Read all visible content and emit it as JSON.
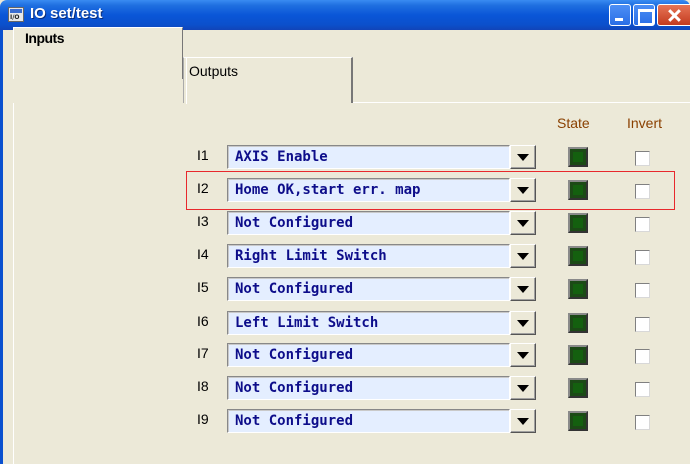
{
  "window": {
    "title": "IO set/test",
    "icon_label": "I/O"
  },
  "tabs": [
    {
      "label": "Inputs",
      "active": true
    },
    {
      "label": "Outputs",
      "active": false
    }
  ],
  "columns": {
    "state": "State",
    "invert": "Invert"
  },
  "inputs": [
    {
      "id": "I1",
      "function": "AXIS Enable",
      "state_on": true,
      "invert": false
    },
    {
      "id": "I2",
      "function": "Home OK,start err. map",
      "state_on": true,
      "invert": false
    },
    {
      "id": "I3",
      "function": "Not Configured",
      "state_on": true,
      "invert": false
    },
    {
      "id": "I4",
      "function": "Right Limit Switch",
      "state_on": true,
      "invert": false
    },
    {
      "id": "I5",
      "function": "Not Configured",
      "state_on": true,
      "invert": false
    },
    {
      "id": "I6",
      "function": "Left Limit Switch",
      "state_on": true,
      "invert": false
    },
    {
      "id": "I7",
      "function": "Not Configured",
      "state_on": true,
      "invert": false
    },
    {
      "id": "I8",
      "function": "Not Configured",
      "state_on": true,
      "invert": false
    },
    {
      "id": "I9",
      "function": "Not Configured",
      "state_on": true,
      "invert": false
    }
  ],
  "colors": {
    "title_bar": "#0a56d8",
    "combo_text": "#0d0d8a",
    "combo_background": "#e4eeff",
    "column_header": "#8a4000",
    "state_led": "#14600f",
    "highlight_box": "#e8282c"
  },
  "icons": {
    "window": "io-panel-icon",
    "minimize": "minimize-icon",
    "maximize": "maximize-icon",
    "close": "close-icon",
    "dropdown": "chevron-down-icon"
  }
}
